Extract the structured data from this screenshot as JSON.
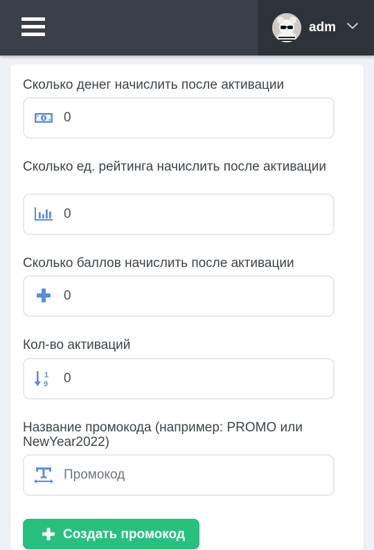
{
  "header": {
    "menu_icon": "hamburger-icon",
    "username": "adm",
    "avatar_icon": "avatar",
    "dropdown_icon": "chevron-down-icon"
  },
  "form": {
    "money": {
      "label": "Сколько денег начислить после активации",
      "value": "0",
      "icon": "money-bill-icon"
    },
    "rating": {
      "label": "Сколько ед. рейтинга начислить после активации",
      "value": "0",
      "icon": "bar-chart-icon"
    },
    "points": {
      "label": "Сколько баллов начислить после активации",
      "value": "0",
      "icon": "plus-icon"
    },
    "activations": {
      "label": "Кол-во активаций",
      "value": "0",
      "icon": "sort-numeric-icon"
    },
    "promo_name": {
      "label": "Название промокода (например: PROMO или NewYear2022)",
      "value": "",
      "placeholder": "Промокод",
      "icon": "text-height-icon"
    },
    "submit_label": "Создать промокод"
  },
  "colors": {
    "header_bg": "#3a4047",
    "user_bg": "#2e3339",
    "icon_blue": "#5b8fd6",
    "button_green": "#27c17d"
  }
}
